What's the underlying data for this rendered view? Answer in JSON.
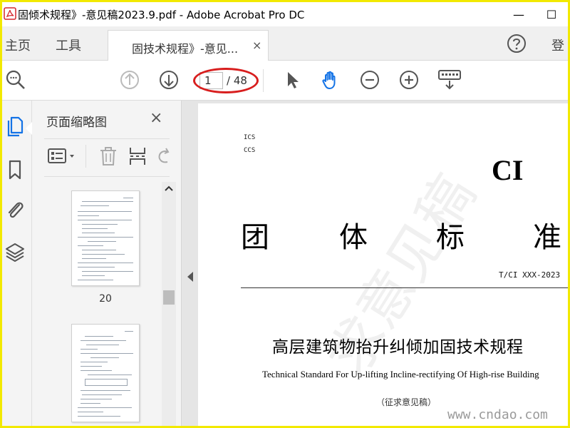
{
  "window": {
    "title": "固倾术规程》-意见稿2023.9.pdf - Adobe Acrobat Pro DC",
    "minimize": "—",
    "maximize": "☐"
  },
  "tabbar": {
    "home": "主页",
    "tools": "工具",
    "doc_tab_label": "固技术规程》-意见...",
    "doc_tab_close": "×",
    "signin": "登"
  },
  "toolbar": {
    "current_page": "1",
    "total_pages": "/ 48"
  },
  "panel": {
    "title": "页面缩略图",
    "close": "×",
    "thumbnails": [
      {
        "page_number": "20"
      },
      {
        "page_number": ""
      }
    ]
  },
  "document": {
    "ics": "ICS",
    "ccs": "CCS",
    "logo": "CI",
    "standard_chars": [
      "团",
      "体",
      "标",
      "准"
    ],
    "standard_no": "T/CI XXX-2023",
    "title_zh": "高层建筑物抬升纠倾加固技术规程",
    "title_en": "Technical Standard For Up-lifting Incline-rectifying Of High-rise Building",
    "draft_note": "（征求意见稿）",
    "watermark": "求意见稿"
  },
  "overlay": {
    "site": "www.cndao.com"
  },
  "colors": {
    "frame_border": "#f2e900",
    "annotation_ellipse": "#d81e1e",
    "icon": "#555555",
    "hand_tool": "#1473e6",
    "app_icon_red": "#d4272d"
  }
}
